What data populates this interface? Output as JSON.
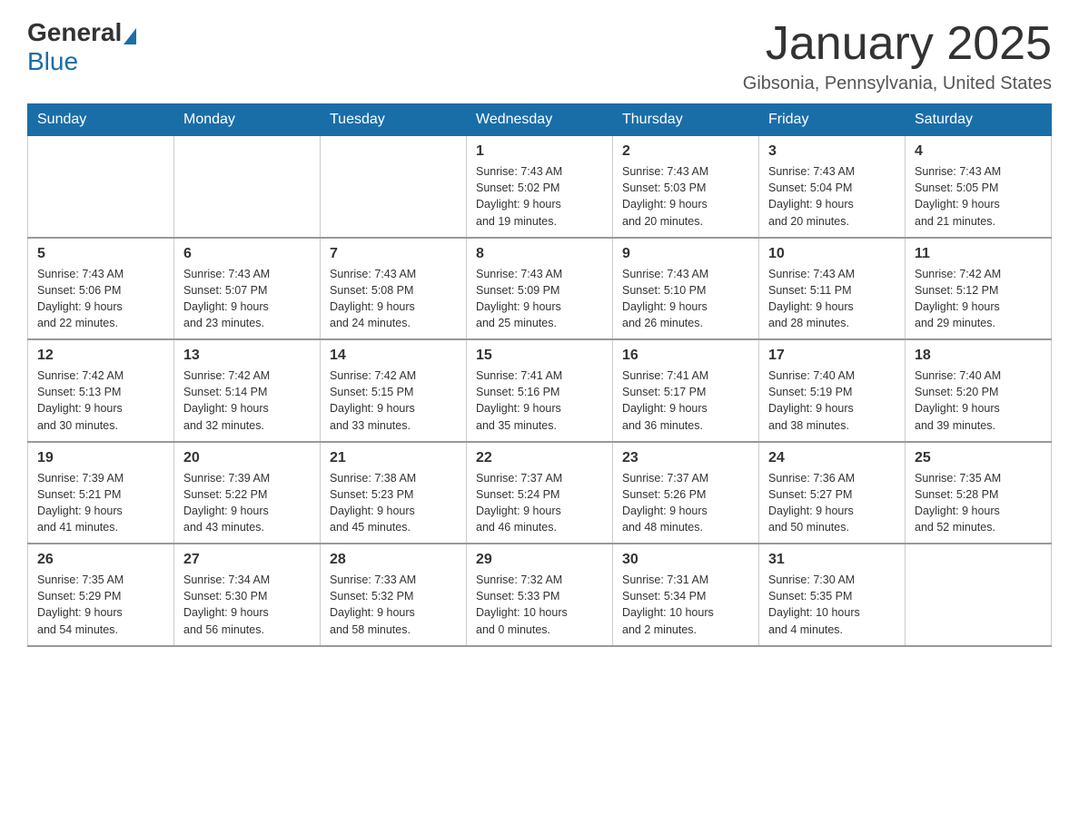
{
  "logo": {
    "general": "General",
    "blue": "Blue"
  },
  "title": "January 2025",
  "location": "Gibsonia, Pennsylvania, United States",
  "days_of_week": [
    "Sunday",
    "Monday",
    "Tuesday",
    "Wednesday",
    "Thursday",
    "Friday",
    "Saturday"
  ],
  "weeks": [
    [
      {
        "day": "",
        "info": ""
      },
      {
        "day": "",
        "info": ""
      },
      {
        "day": "",
        "info": ""
      },
      {
        "day": "1",
        "info": "Sunrise: 7:43 AM\nSunset: 5:02 PM\nDaylight: 9 hours\nand 19 minutes."
      },
      {
        "day": "2",
        "info": "Sunrise: 7:43 AM\nSunset: 5:03 PM\nDaylight: 9 hours\nand 20 minutes."
      },
      {
        "day": "3",
        "info": "Sunrise: 7:43 AM\nSunset: 5:04 PM\nDaylight: 9 hours\nand 20 minutes."
      },
      {
        "day": "4",
        "info": "Sunrise: 7:43 AM\nSunset: 5:05 PM\nDaylight: 9 hours\nand 21 minutes."
      }
    ],
    [
      {
        "day": "5",
        "info": "Sunrise: 7:43 AM\nSunset: 5:06 PM\nDaylight: 9 hours\nand 22 minutes."
      },
      {
        "day": "6",
        "info": "Sunrise: 7:43 AM\nSunset: 5:07 PM\nDaylight: 9 hours\nand 23 minutes."
      },
      {
        "day": "7",
        "info": "Sunrise: 7:43 AM\nSunset: 5:08 PM\nDaylight: 9 hours\nand 24 minutes."
      },
      {
        "day": "8",
        "info": "Sunrise: 7:43 AM\nSunset: 5:09 PM\nDaylight: 9 hours\nand 25 minutes."
      },
      {
        "day": "9",
        "info": "Sunrise: 7:43 AM\nSunset: 5:10 PM\nDaylight: 9 hours\nand 26 minutes."
      },
      {
        "day": "10",
        "info": "Sunrise: 7:43 AM\nSunset: 5:11 PM\nDaylight: 9 hours\nand 28 minutes."
      },
      {
        "day": "11",
        "info": "Sunrise: 7:42 AM\nSunset: 5:12 PM\nDaylight: 9 hours\nand 29 minutes."
      }
    ],
    [
      {
        "day": "12",
        "info": "Sunrise: 7:42 AM\nSunset: 5:13 PM\nDaylight: 9 hours\nand 30 minutes."
      },
      {
        "day": "13",
        "info": "Sunrise: 7:42 AM\nSunset: 5:14 PM\nDaylight: 9 hours\nand 32 minutes."
      },
      {
        "day": "14",
        "info": "Sunrise: 7:42 AM\nSunset: 5:15 PM\nDaylight: 9 hours\nand 33 minutes."
      },
      {
        "day": "15",
        "info": "Sunrise: 7:41 AM\nSunset: 5:16 PM\nDaylight: 9 hours\nand 35 minutes."
      },
      {
        "day": "16",
        "info": "Sunrise: 7:41 AM\nSunset: 5:17 PM\nDaylight: 9 hours\nand 36 minutes."
      },
      {
        "day": "17",
        "info": "Sunrise: 7:40 AM\nSunset: 5:19 PM\nDaylight: 9 hours\nand 38 minutes."
      },
      {
        "day": "18",
        "info": "Sunrise: 7:40 AM\nSunset: 5:20 PM\nDaylight: 9 hours\nand 39 minutes."
      }
    ],
    [
      {
        "day": "19",
        "info": "Sunrise: 7:39 AM\nSunset: 5:21 PM\nDaylight: 9 hours\nand 41 minutes."
      },
      {
        "day": "20",
        "info": "Sunrise: 7:39 AM\nSunset: 5:22 PM\nDaylight: 9 hours\nand 43 minutes."
      },
      {
        "day": "21",
        "info": "Sunrise: 7:38 AM\nSunset: 5:23 PM\nDaylight: 9 hours\nand 45 minutes."
      },
      {
        "day": "22",
        "info": "Sunrise: 7:37 AM\nSunset: 5:24 PM\nDaylight: 9 hours\nand 46 minutes."
      },
      {
        "day": "23",
        "info": "Sunrise: 7:37 AM\nSunset: 5:26 PM\nDaylight: 9 hours\nand 48 minutes."
      },
      {
        "day": "24",
        "info": "Sunrise: 7:36 AM\nSunset: 5:27 PM\nDaylight: 9 hours\nand 50 minutes."
      },
      {
        "day": "25",
        "info": "Sunrise: 7:35 AM\nSunset: 5:28 PM\nDaylight: 9 hours\nand 52 minutes."
      }
    ],
    [
      {
        "day": "26",
        "info": "Sunrise: 7:35 AM\nSunset: 5:29 PM\nDaylight: 9 hours\nand 54 minutes."
      },
      {
        "day": "27",
        "info": "Sunrise: 7:34 AM\nSunset: 5:30 PM\nDaylight: 9 hours\nand 56 minutes."
      },
      {
        "day": "28",
        "info": "Sunrise: 7:33 AM\nSunset: 5:32 PM\nDaylight: 9 hours\nand 58 minutes."
      },
      {
        "day": "29",
        "info": "Sunrise: 7:32 AM\nSunset: 5:33 PM\nDaylight: 10 hours\nand 0 minutes."
      },
      {
        "day": "30",
        "info": "Sunrise: 7:31 AM\nSunset: 5:34 PM\nDaylight: 10 hours\nand 2 minutes."
      },
      {
        "day": "31",
        "info": "Sunrise: 7:30 AM\nSunset: 5:35 PM\nDaylight: 10 hours\nand 4 minutes."
      },
      {
        "day": "",
        "info": ""
      }
    ]
  ]
}
